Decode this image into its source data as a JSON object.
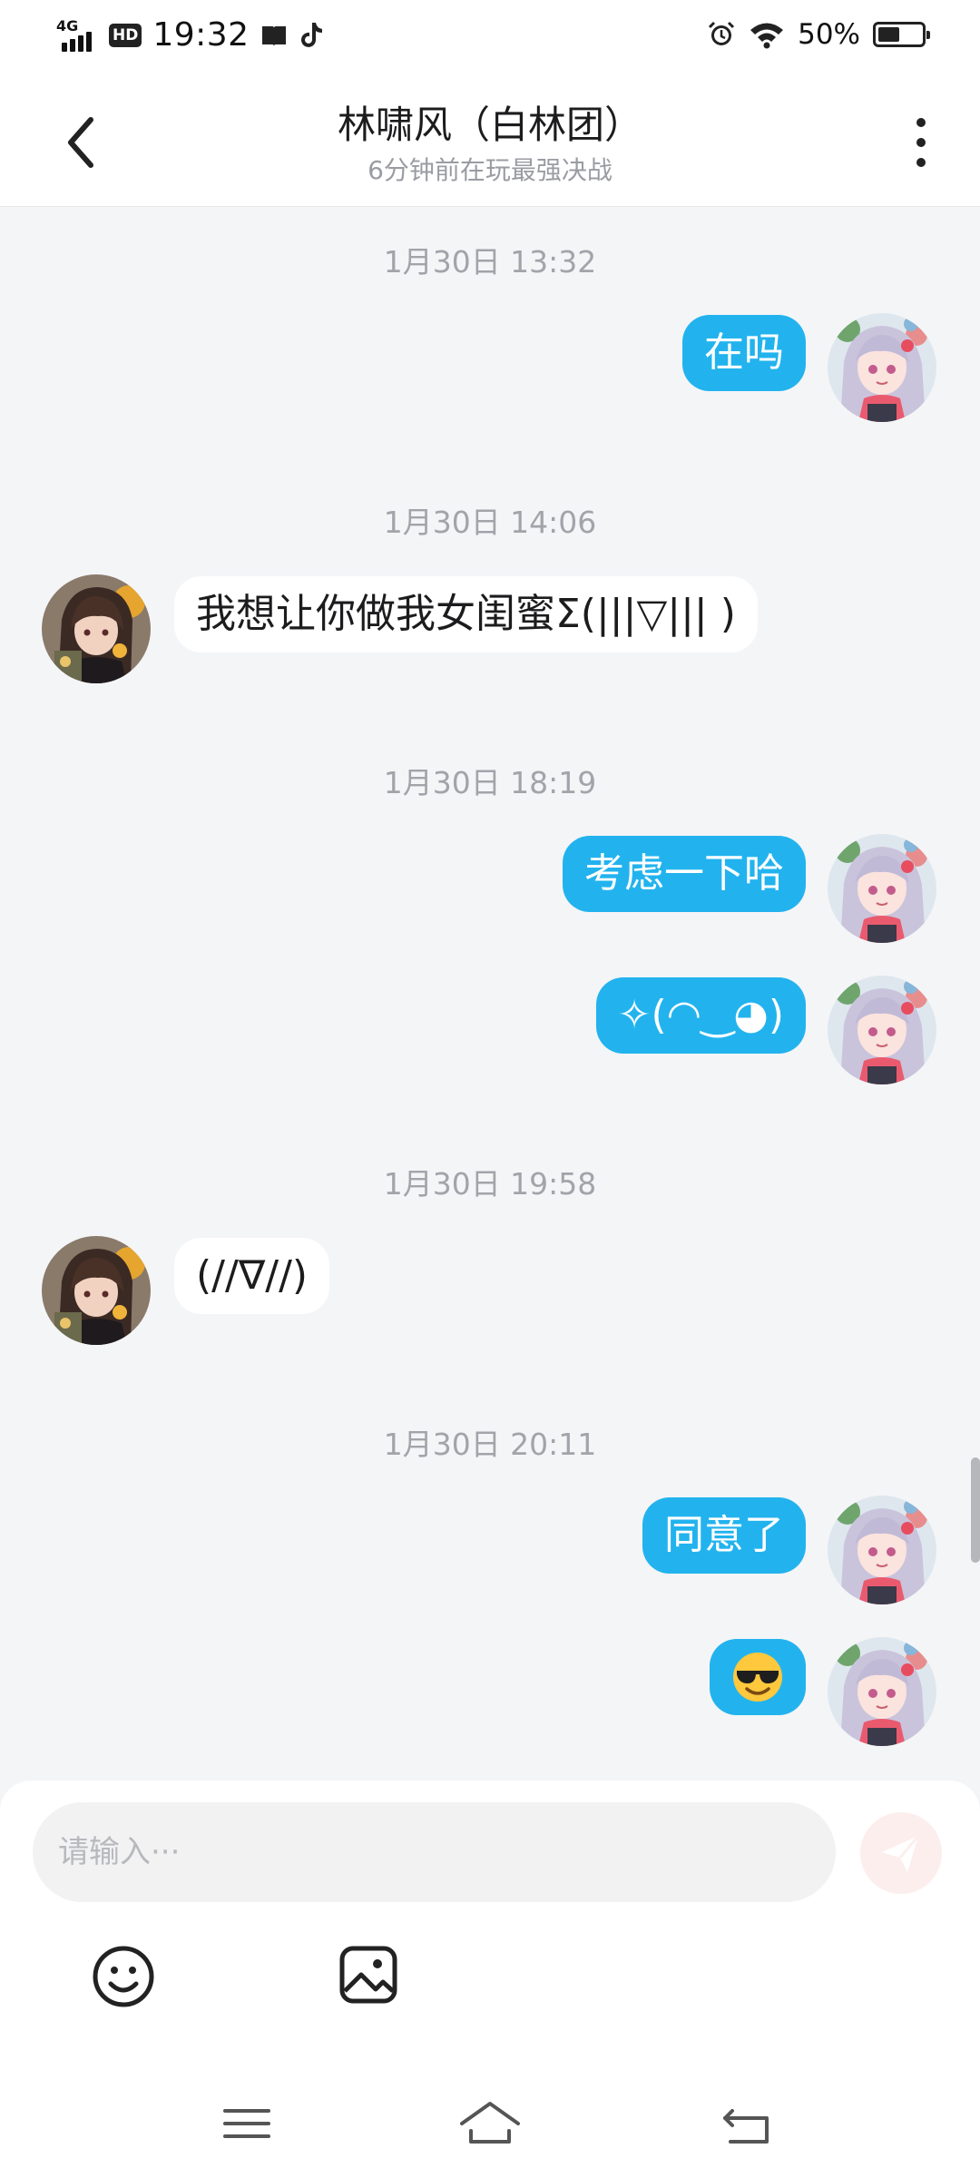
{
  "status_bar": {
    "network": "4G",
    "hd": "HD",
    "time": "19:32",
    "battery_text": "50%",
    "battery_level": 0.5
  },
  "header": {
    "title": "林啸风（白林团）",
    "subtitle": "6分钟前在玩最强决战"
  },
  "messages": [
    {
      "timestamp": "1月30日  13:32"
    },
    {
      "direction": "out",
      "text": "在吗"
    },
    {
      "timestamp": "1月30日  14:06"
    },
    {
      "direction": "in",
      "text": "我想让你做我女闺蜜Σ(|||▽||| )"
    },
    {
      "timestamp": "1月30日  18:19"
    },
    {
      "direction": "out",
      "text": "考虑一下哈"
    },
    {
      "direction": "out",
      "text": "✧(◠‿◕)"
    },
    {
      "timestamp": "1月30日  19:58"
    },
    {
      "direction": "in",
      "text": "(//∇//)"
    },
    {
      "timestamp": "1月30日  20:11"
    },
    {
      "direction": "out",
      "text": "同意了"
    },
    {
      "direction": "out",
      "emoji": "sunglasses-emoji"
    }
  ],
  "input": {
    "placeholder": "请输入···",
    "value": ""
  },
  "colors": {
    "outgoing_bubble": "#22b3ee",
    "incoming_bubble": "#ffffff",
    "chat_background": "#f4f5f7",
    "send_button": "#fdeeee"
  },
  "icons": {
    "back": "chevron-left-icon",
    "more": "more-vertical-icon",
    "send": "send-icon",
    "emoji": "smiley-icon",
    "image": "image-icon",
    "nav_menu": "menu-icon",
    "nav_home": "home-icon",
    "nav_back": "return-icon"
  }
}
